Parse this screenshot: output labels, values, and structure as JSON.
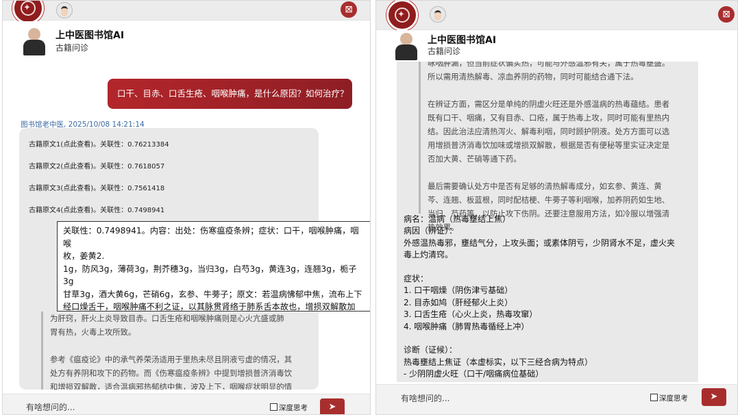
{
  "app": {
    "title": "上中医图书馆AI",
    "subtitle": "古籍问诊",
    "input_placeholder": "有啥想问的...",
    "deep_thinking_label": "深度思考"
  },
  "colors": {
    "accent": "#a82e2e",
    "meta": "#3b6aa3"
  },
  "icons": {
    "close": "close-x-icon",
    "send": "send-arrow-icon",
    "logo": "university-seal-icon"
  },
  "left": {
    "user_question": "口干、目赤、口舌生疮、咽喉肿痛，是什么原因？如何治疗？",
    "answer_meta": "图书馆老中医, 2025/10/08 14:21:14",
    "references": [
      "古籍原文1(点此查看)。关联性：0.76213384",
      "古籍原文2(点此查看)。关联性：0.7618057",
      "古籍原文3(点此查看)。关联性：0.7561418",
      "古籍原文4(点此查看)。关联性：0.7498941"
    ],
    "popup_text": "关联性：0.7498941。内容：出处：伤寒瘟疫条辨；症状：口干，咽喉肿痛，咽喉\n枚，姜黄2.\n1g，防风3g，薄荷3g，荆芥穗3g，当归3g，白芍3g，黄连3g，连翘3g，栀子3g\n甘草3g，酒大黄6g，芒硝6g，玄参、牛蒡子；原文：若温病怫郁中焦，流布上下\n经口燥舌干，咽喉肿痛不利之证，以其脉贯肾络于肺系舌本故也，增损双解散加\n肾络于肺系舌本故也。；病名：温病；方剂：增损双解散加味；用法：水煎去渣\n冷服。",
    "quote_text": "为肝窍，肝火上炎导致目赤。口舌生疮和咽喉肿痛则是心火亢盛或肺\n胃有热，火毒上攻所致。\n\n参考《瘟疫论》中的承气养荣汤适用于里热未尽且阴液亏虚的情况，其\n处方有养阴和攻下的药物。而《伤寒瘟疫条辨》中提到增损普济消毒饮\n和增损双解散，适合温病邪热郁结中焦，波及上下，咽喉症状明显的情"
  },
  "right": {
    "quote_text": "咏咽肿漏，但当前症状偏实热，可能与外感温邪有关，属于热毒壅盛。\n所以需用清热解毒、凉血养阴的药物，同时可能结合通下法。\n\n在辨证方面，需区分是单纯的阴虚火旺还是外感温病的热毒蕴结。患者\n既有口干、咽痛，又有目赤、口疮，属于热毒上攻，同时可能有里热内\n结。因此治法应清热泻火、解毒利咽，同时顾护阴液。处方方面可以选\n用增损普济消毒饮加味或增损双解散，根据是否有便秘等里实证决定是\n否加大黄、芒硝等通下药。\n\n最后需要确认处方中是否有足够的清热解毒成分，如玄参、黄连、黄\n芩、连翘、板蓝根，同时配桔梗、牛蒡子等利咽喉，加养阴药如生地、\n当归、芍药等，以防止攻下伤阴。还要注意服用方法，如冷服以增强清\n热效果。",
    "answer_text": "病名：温病（热毒壅结上焦）\n病因（辨证）：\n外感温热毒邪，壅结气分，上攻头面；或素体阴亏，少阴肾水不足，虚火夹\n毒上灼清窍。\n\n症状：\n1. 口干咽燥（阴伤津亏基础）\n2. 目赤如鸠（肝经郁火上炎）\n3. 口舌生疮（心火上炎，热毒攻窜）\n4. 咽喉肿痛（肺胃热毒循经上冲）\n\n诊断（证候）：\n热毒壅结上焦证（本虚标实，以下三经合病为特点）\n- 少阴阴虚火旺（口干/咽痛病位基础）"
  }
}
